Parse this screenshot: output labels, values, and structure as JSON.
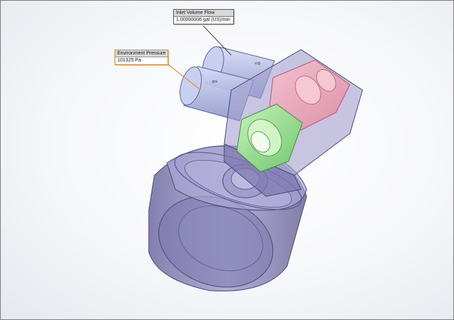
{
  "callouts": {
    "inlet": {
      "title": "Inlet Volume Flow",
      "value": "1.00000006 gal (US)/min",
      "leader_color": "#444444"
    },
    "environment": {
      "title": "Environment Pressure",
      "value": "101325 Pa",
      "leader_color": "#e8912d"
    }
  },
  "colors": {
    "body": "#8c88b8",
    "body_dark": "#5d5a8a",
    "pipe": "#b9c2ec",
    "green_region": "#8fe07f",
    "red_region": "#f2a7b8",
    "background": "#f4f5f8"
  }
}
